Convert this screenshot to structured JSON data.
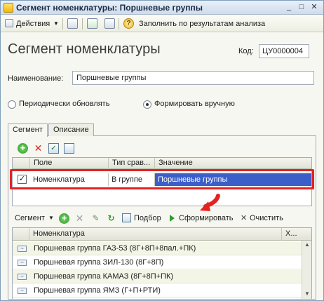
{
  "window": {
    "title": "Сегмент номенклатуры: Поршневые группы"
  },
  "toolbar": {
    "actions_label": "Действия",
    "fill_label": "Заполнить по результатам анализа"
  },
  "form": {
    "heading": "Сегмент номенклатуры",
    "code_label": "Код:",
    "code_value": "ЦУ0000004",
    "name_label": "Наименование:",
    "name_value": "Поршневые группы",
    "radio_periodic": "Периодически обновлять",
    "radio_manual": "Формировать вручную",
    "radio_selected": "manual"
  },
  "tabs": [
    "Сегмент",
    "Описание"
  ],
  "filter_table": {
    "columns": [
      "Поле",
      "Тип срав...",
      "Значение"
    ],
    "rows": [
      {
        "checked": true,
        "field": "Номенклатура",
        "compare": "В группе",
        "value": "Поршневые группы"
      }
    ]
  },
  "segment_toolbar": {
    "segment_label": "Сегмент",
    "select_label": "Подбор",
    "form_label": "Сформировать",
    "clear_label": "Очистить"
  },
  "result_table": {
    "columns": [
      "Номенклатура",
      "Х..."
    ],
    "rows": [
      "Поршневая группа ГАЗ-53 (8Г+8П+8пал.+ПК)",
      "Поршневая группа ЗИЛ-130 (8Г+8П)",
      "Поршневая группа КАМАЗ (8Г+8П+ПК)",
      "Поршневая группа ЯМЗ (Г+П+РТИ)"
    ]
  },
  "colors": {
    "highlight_frame": "#e52222",
    "selected_cell": "#3c5ec8",
    "arrow": "#e52222"
  }
}
